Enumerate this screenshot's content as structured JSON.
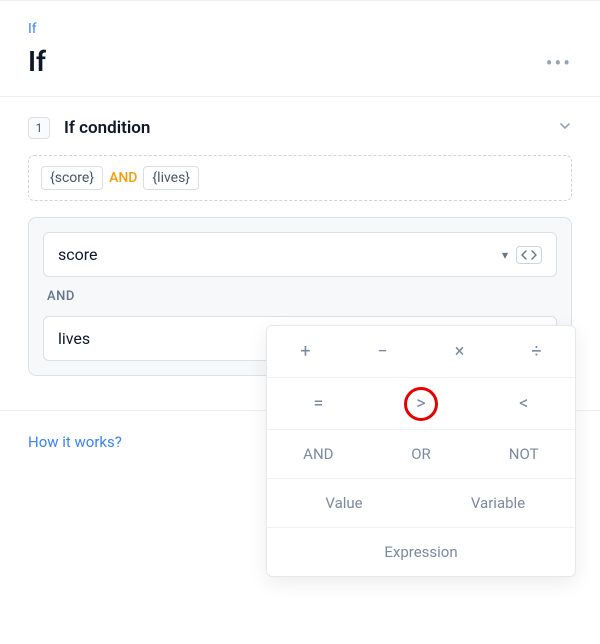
{
  "header": {
    "breadcrumb": "If",
    "title": "If",
    "more": "•••"
  },
  "section": {
    "step": "1",
    "title": "If condition",
    "preview": {
      "chip1": "{score}",
      "connector": "AND",
      "chip2": "{lives}"
    },
    "input1": "score",
    "connector": "AND",
    "input2": "lives",
    "dropdown_caret": "▾"
  },
  "footer": {
    "how_link": "How it works?"
  },
  "popup": {
    "row1": {
      "plus": "+",
      "minus": "−",
      "times": "×",
      "divide": "÷"
    },
    "row2": {
      "eq": "=",
      "gt": ">",
      "lt": "<"
    },
    "row3": {
      "and": "AND",
      "or": "OR",
      "not": "NOT"
    },
    "row4": {
      "value": "Value",
      "variable": "Variable"
    },
    "row5": {
      "expression": "Expression"
    }
  }
}
